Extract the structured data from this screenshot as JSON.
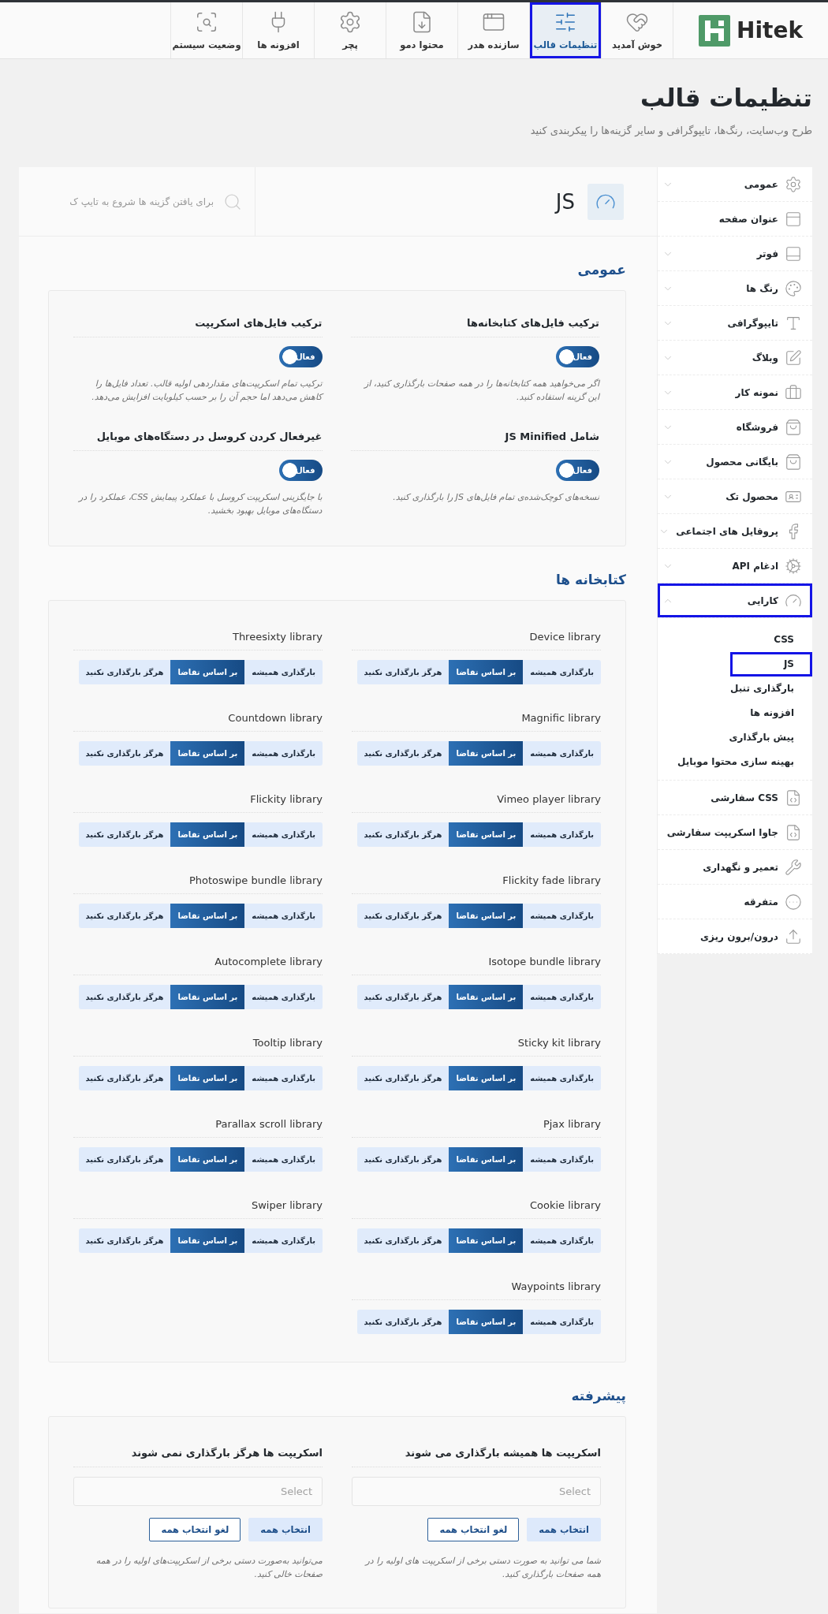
{
  "top_nav": {
    "logo": "Hitek",
    "tabs": [
      {
        "label": "خوش آمدید",
        "selected": false
      },
      {
        "label": "تنظیمات قالب",
        "selected": true
      },
      {
        "label": "سازنده هدر",
        "selected": false
      },
      {
        "label": "محتوا دمو",
        "selected": false
      },
      {
        "label": "پچر",
        "selected": false
      },
      {
        "label": "افزونه ها",
        "selected": false
      },
      {
        "label": "وضعیت سیستم",
        "selected": false
      }
    ]
  },
  "page_header": {
    "title": "تنظیمات قالب",
    "subtitle": "طرح وب‌سایت، رنگ‌ها، تایپوگرافی و سایر گزینه‌ها را پیکربندی کنید"
  },
  "sidebar": {
    "items": [
      {
        "label": "عمومی",
        "expanded": false,
        "selected": false
      },
      {
        "label": "عنوان صفحه",
        "selected": false
      },
      {
        "label": "فوتر",
        "expanded": false,
        "selected": false
      },
      {
        "label": "رنگ ها",
        "expanded": false,
        "selected": false
      },
      {
        "label": "تایپوگرافی",
        "expanded": false,
        "selected": false
      },
      {
        "label": "وبلاگ",
        "expanded": false,
        "selected": false
      },
      {
        "label": "نمونه کار",
        "expanded": false,
        "selected": false
      },
      {
        "label": "فروشگاه",
        "expanded": false,
        "selected": false
      },
      {
        "label": "بایگانی محصول",
        "expanded": false,
        "selected": false
      },
      {
        "label": "محصول تک",
        "expanded": false,
        "selected": false
      },
      {
        "label": "پروفایل های اجتماعی",
        "expanded": false,
        "selected": false
      },
      {
        "label": "ادغام API",
        "expanded": false,
        "selected": false
      },
      {
        "label": "کارایی",
        "expanded": true,
        "selected": true,
        "children": [
          {
            "label": "CSS",
            "selected": false
          },
          {
            "label": "JS",
            "selected": true
          },
          {
            "label": "بارگذاری تنبل",
            "selected": false
          },
          {
            "label": "افزونه ها",
            "selected": false
          },
          {
            "label": "پیش بارگذاری",
            "selected": false
          },
          {
            "label": "بهینه سازی محتوا موبایل",
            "selected": false
          }
        ]
      },
      {
        "label": "CSS سفارشی",
        "selected": false
      },
      {
        "label": "جاوا اسکریپت سفارشی",
        "selected": false
      },
      {
        "label": "تعمیر و نگهداری",
        "selected": false
      },
      {
        "label": "متفرقه",
        "selected": false
      },
      {
        "label": "درون/برون ریزی",
        "selected": false
      }
    ]
  },
  "content": {
    "header": {
      "title": "JS",
      "search": {
        "placeholder": "برای یافتن گزینه ها شروع به تایپ ک"
      }
    },
    "sections": [
      {
        "kind": "toggles",
        "heading": "عمومی",
        "fields": [
          {
            "title": "ترکیب فایل‌های کتابخانه‌ها",
            "toggle": {
              "on": true,
              "label": "فعال"
            },
            "description": "اگر می‌خواهید همه کتابخانه‌ها را در همه صفحات بارگذاری کنید، از این گزینه استفاده کنید."
          },
          {
            "title": "ترکیب فایل‌های اسکریپت",
            "toggle": {
              "on": true,
              "label": "فعال"
            },
            "description": "ترکیب تمام اسکریپت‌های مقداردهی اولیه قالب. تعداد فایل‌ها را کاهش می‌دهد اما حجم آن را بر حسب کیلوبایت افزایش می‌دهد."
          },
          {
            "title": "شامل JS Minified",
            "toggle": {
              "on": true,
              "label": "فعال"
            },
            "description": "نسخه‌های کوچک‌شده‌ی تمام فایل‌های JS را بارگذاری کنید."
          },
          {
            "title": "غیرفعال کردن کروسل در دستگاه‌های موبایل",
            "toggle": {
              "on": true,
              "label": "فعال"
            },
            "description": "با جایگزینی اسکریپت کروسل با عملکرد پیمایش CSS، عملکرد را در دستگاه‌های موبایل بهبود بخشید."
          }
        ]
      },
      {
        "kind": "libraries",
        "heading": "کتابخانه ها",
        "libraries": [
          {
            "name": "Device library",
            "options": [
              {
                "label": "بارگذاری همیشه",
                "selected": false
              },
              {
                "label": "بر اساس تقاضا",
                "selected": true
              },
              {
                "label": "هرگز بارگذاری نکنید",
                "selected": false
              }
            ]
          },
          {
            "name": "Threesixty library",
            "options": [
              {
                "label": "بارگذاری همیشه",
                "selected": false
              },
              {
                "label": "بر اساس تقاضا",
                "selected": true
              },
              {
                "label": "هرگز بارگذاری نکنید",
                "selected": false
              }
            ]
          },
          {
            "name": "Magnific library",
            "options": [
              {
                "label": "بارگذاری همیشه",
                "selected": false
              },
              {
                "label": "بر اساس تقاضا",
                "selected": true
              },
              {
                "label": "هرگز بارگذاری نکنید",
                "selected": false
              }
            ]
          },
          {
            "name": "Countdown library",
            "options": [
              {
                "label": "بارگذاری همیشه",
                "selected": false
              },
              {
                "label": "بر اساس تقاضا",
                "selected": true
              },
              {
                "label": "هرگز بارگذاری نکنید",
                "selected": false
              }
            ]
          },
          {
            "name": "Vimeo player library",
            "options": [
              {
                "label": "بارگذاری همیشه",
                "selected": false
              },
              {
                "label": "بر اساس تقاضا",
                "selected": true
              },
              {
                "label": "هرگز بارگذاری نکنید",
                "selected": false
              }
            ]
          },
          {
            "name": "Flickity library",
            "options": [
              {
                "label": "بارگذاری همیشه",
                "selected": false
              },
              {
                "label": "بر اساس تقاضا",
                "selected": true
              },
              {
                "label": "هرگز بارگذاری نکنید",
                "selected": false
              }
            ]
          },
          {
            "name": "Flickity fade library",
            "options": [
              {
                "label": "بارگذاری همیشه",
                "selected": false
              },
              {
                "label": "بر اساس تقاضا",
                "selected": true
              },
              {
                "label": "هرگز بارگذاری نکنید",
                "selected": false
              }
            ]
          },
          {
            "name": "Photoswipe bundle library",
            "options": [
              {
                "label": "بارگذاری همیشه",
                "selected": false
              },
              {
                "label": "بر اساس تقاضا",
                "selected": true
              },
              {
                "label": "هرگز بارگذاری نکنید",
                "selected": false
              }
            ]
          },
          {
            "name": "Isotope bundle library",
            "options": [
              {
                "label": "بارگذاری همیشه",
                "selected": false
              },
              {
                "label": "بر اساس تقاضا",
                "selected": true
              },
              {
                "label": "هرگز بارگذاری نکنید",
                "selected": false
              }
            ]
          },
          {
            "name": "Autocomplete library",
            "options": [
              {
                "label": "بارگذاری همیشه",
                "selected": false
              },
              {
                "label": "بر اساس تقاضا",
                "selected": true
              },
              {
                "label": "هرگز بارگذاری نکنید",
                "selected": false
              }
            ]
          },
          {
            "name": "Sticky kit library",
            "options": [
              {
                "label": "بارگذاری همیشه",
                "selected": false
              },
              {
                "label": "بر اساس تقاضا",
                "selected": true
              },
              {
                "label": "هرگز بارگذاری نکنید",
                "selected": false
              }
            ]
          },
          {
            "name": "Tooltip library",
            "options": [
              {
                "label": "بارگذاری همیشه",
                "selected": false
              },
              {
                "label": "بر اساس تقاضا",
                "selected": true
              },
              {
                "label": "هرگز بارگذاری نکنید",
                "selected": false
              }
            ]
          },
          {
            "name": "Pjax library",
            "options": [
              {
                "label": "بارگذاری همیشه",
                "selected": false
              },
              {
                "label": "بر اساس تقاضا",
                "selected": true
              },
              {
                "label": "هرگز بارگذاری نکنید",
                "selected": false
              }
            ]
          },
          {
            "name": "Parallax scroll library",
            "options": [
              {
                "label": "بارگذاری همیشه",
                "selected": false
              },
              {
                "label": "بر اساس تقاضا",
                "selected": true
              },
              {
                "label": "هرگز بارگذاری نکنید",
                "selected": false
              }
            ]
          },
          {
            "name": "Cookie library",
            "options": [
              {
                "label": "بارگذاری همیشه",
                "selected": false
              },
              {
                "label": "بر اساس تقاضا",
                "selected": true
              },
              {
                "label": "هرگز بارگذاری نکنید",
                "selected": false
              }
            ]
          },
          {
            "name": "Swiper library",
            "options": [
              {
                "label": "بارگذاری همیشه",
                "selected": false
              },
              {
                "label": "بر اساس تقاضا",
                "selected": true
              },
              {
                "label": "هرگز بارگذاری نکنید",
                "selected": false
              }
            ]
          },
          {
            "name": "Waypoints library",
            "options": [
              {
                "label": "بارگذاری همیشه",
                "selected": false
              },
              {
                "label": "بر اساس تقاضا",
                "selected": true
              },
              {
                "label": "هرگز بارگذاری نکنید",
                "selected": false
              }
            ]
          }
        ]
      },
      {
        "kind": "selects",
        "heading": "پیشرفته",
        "fields": [
          {
            "title": "اسکریپت ها همیشه بارگذاری می شوند",
            "select": {
              "placeholder": "Select"
            },
            "buttons": [
              {
                "label": "انتخاب همه",
                "kind": "filled"
              },
              {
                "label": "لغو انتخاب همه",
                "kind": "outline"
              }
            ],
            "description": "شما می توانید به صورت دستی برخی از اسکریپت های اولیه را در همه صفحات بارگذاری کنید."
          },
          {
            "title": "اسکریپت ها هرگز بارگذاری نمی شوند",
            "select": {
              "placeholder": "Select"
            },
            "buttons": [
              {
                "label": "انتخاب همه",
                "kind": "filled"
              },
              {
                "label": "لغو انتخاب همه",
                "kind": "outline"
              }
            ],
            "description": "می‌توانید به‌صورت دستی برخی از اسکریپت‌های اولیه را در همه صفحات خالی کنید."
          }
        ]
      }
    ]
  }
}
